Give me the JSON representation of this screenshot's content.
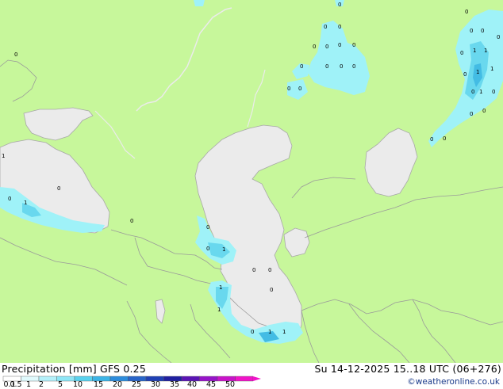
{
  "map": {
    "colors": {
      "land": "#c7f79b",
      "water": "#ebebeb",
      "border": "#9a9a9a",
      "coast": "#a8a8a8",
      "precip_light": "#9ff2f8",
      "precip_mid": "#69d8ee",
      "precip_heavy": "#43bce4"
    },
    "precip_value_labels": [
      "0",
      "0",
      "0",
      "0",
      "0",
      "0",
      "0",
      "0",
      "0",
      "0",
      "0",
      "0",
      "0",
      "0",
      "1",
      "1",
      "1",
      "0",
      "1",
      "0",
      "0",
      "0",
      "0",
      "0",
      "0",
      "0",
      "1",
      "0",
      "0",
      "0",
      "0",
      "1",
      "0",
      "0",
      "0",
      "1",
      "0",
      "1",
      "0",
      "1",
      "0",
      "1",
      "0",
      "1",
      "1",
      "0",
      "0"
    ]
  },
  "footer": {
    "title_left": "Precipitation [mm]  GFS 0.25",
    "title_right": "Su 14-12-2025 15..18 UTC (06+276)",
    "credit": "©weatheronline.co.uk",
    "legend_ticks": [
      "0.1",
      "0.5",
      "1",
      "2",
      "5",
      "10",
      "15",
      "20",
      "25",
      "30",
      "35",
      "40",
      "45",
      "50"
    ],
    "legend_colors": [
      "#ffffff",
      "#e0fafd",
      "#b4f0fa",
      "#8ee6f6",
      "#5ad2ee",
      "#3cb4e6",
      "#2d8cdc",
      "#2864c8",
      "#2040b4",
      "#2020a0",
      "#5a14b4",
      "#9614c8",
      "#c814c8",
      "#f014c8"
    ]
  }
}
